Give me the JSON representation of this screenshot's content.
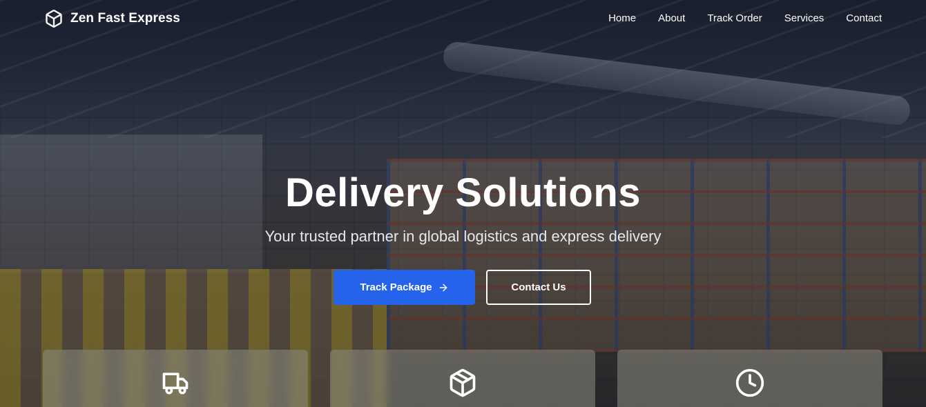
{
  "brand": {
    "name": "Zen Fast Express",
    "icon": "box-icon"
  },
  "nav": {
    "items": [
      {
        "label": "Home"
      },
      {
        "label": "About"
      },
      {
        "label": "Track Order"
      },
      {
        "label": "Services"
      },
      {
        "label": "Contact"
      }
    ]
  },
  "hero": {
    "title": "Delivery Solutions",
    "subtitle": "Your trusted partner in global logistics and express delivery",
    "primary_button": {
      "label": "Track Package",
      "icon": "arrow-right-icon"
    },
    "secondary_button": {
      "label": "Contact Us"
    }
  },
  "features": [
    {
      "icon": "truck-icon"
    },
    {
      "icon": "package-icon"
    },
    {
      "icon": "clock-icon"
    }
  ],
  "colors": {
    "primary": "#2563eb",
    "text": "#ffffff"
  }
}
